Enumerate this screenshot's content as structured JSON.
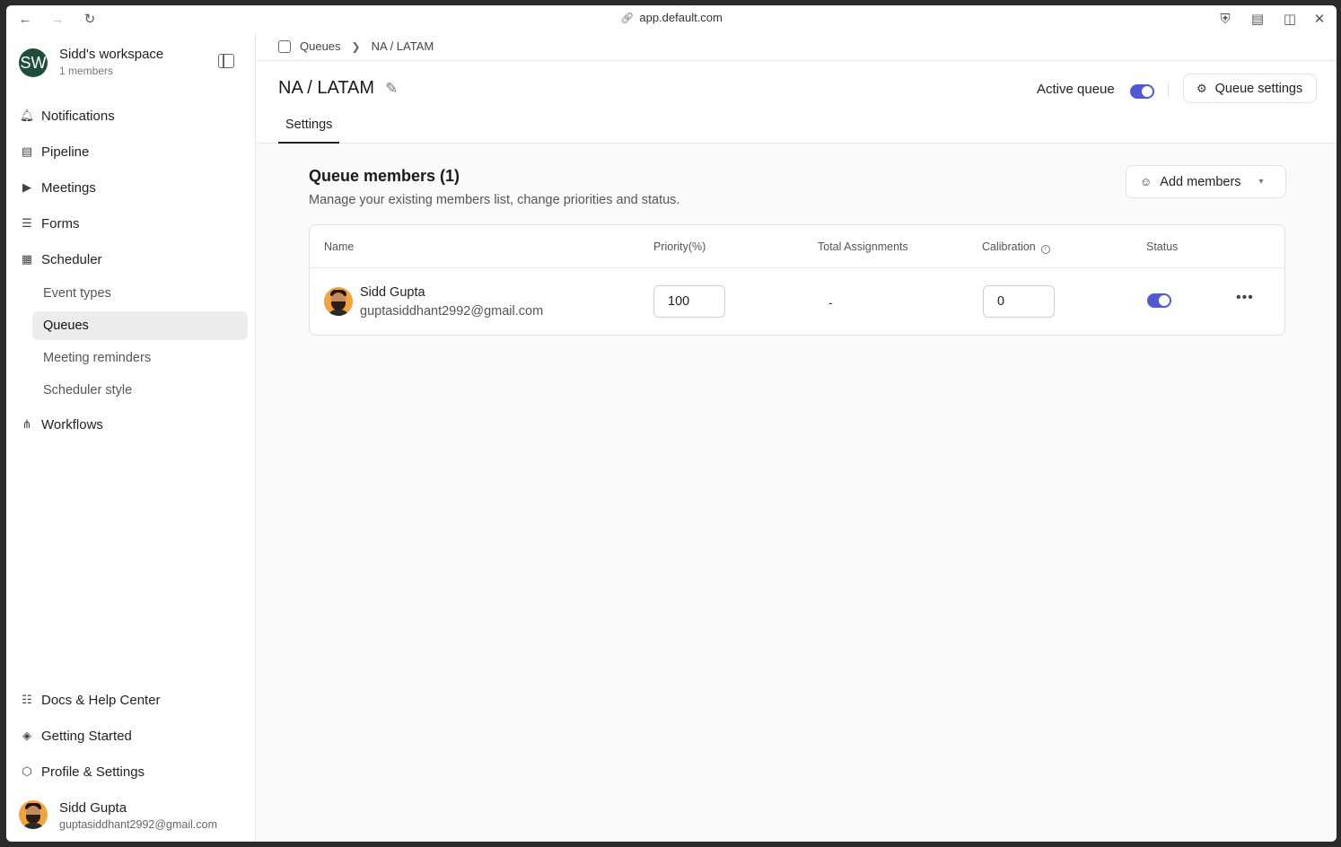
{
  "browser": {
    "url": "app.default.com",
    "icons": [
      "back-icon",
      "forward-icon",
      "reload-icon",
      "link-icon",
      "shield-icon",
      "extensions-icon",
      "split-view-icon",
      "close-icon"
    ]
  },
  "workspace": {
    "initials": "SW",
    "name": "Sidd's workspace",
    "members": "1 members"
  },
  "sidebar": {
    "items": [
      {
        "label": "Notifications",
        "icon": "bell-icon"
      },
      {
        "label": "Pipeline",
        "icon": "table-icon"
      },
      {
        "label": "Meetings",
        "icon": "video-icon"
      },
      {
        "label": "Forms",
        "icon": "form-icon"
      },
      {
        "label": "Scheduler",
        "icon": "calendar-icon"
      }
    ],
    "scheduler_sub": [
      {
        "label": "Event types"
      },
      {
        "label": "Queues",
        "active": true
      },
      {
        "label": "Meeting reminders"
      },
      {
        "label": "Scheduler style"
      }
    ],
    "workflows": {
      "label": "Workflows",
      "icon": "workflow-icon"
    },
    "footer_items": [
      {
        "label": "Docs & Help Center",
        "icon": "book-icon"
      },
      {
        "label": "Getting Started",
        "icon": "graduation-icon"
      },
      {
        "label": "Profile & Settings",
        "icon": "hexagon-icon"
      }
    ],
    "user": {
      "name": "Sidd Gupta",
      "email": "guptasiddhant2992@gmail.com"
    }
  },
  "breadcrumb": {
    "root": "Queues",
    "current": "NA / LATAM"
  },
  "header": {
    "title": "NA / LATAM",
    "active_label": "Active queue",
    "active": true,
    "settings_button": "Queue settings",
    "tab": "Settings"
  },
  "members": {
    "title": "Queue members (1)",
    "subtitle": "Manage your existing members list, change priorities and status.",
    "add_button": "Add members",
    "columns": [
      "Name",
      "Priority(%)",
      "Total Assignments",
      "Calibration",
      "Status"
    ],
    "rows": [
      {
        "name": "Sidd Gupta",
        "email": "guptasiddhant2992@gmail.com",
        "priority": "100",
        "total_assignments": "-",
        "calibration": "0",
        "status": true
      }
    ]
  },
  "colors": {
    "accent": "#4f5bd5",
    "workspace_avatar": "#1e4d3a"
  }
}
